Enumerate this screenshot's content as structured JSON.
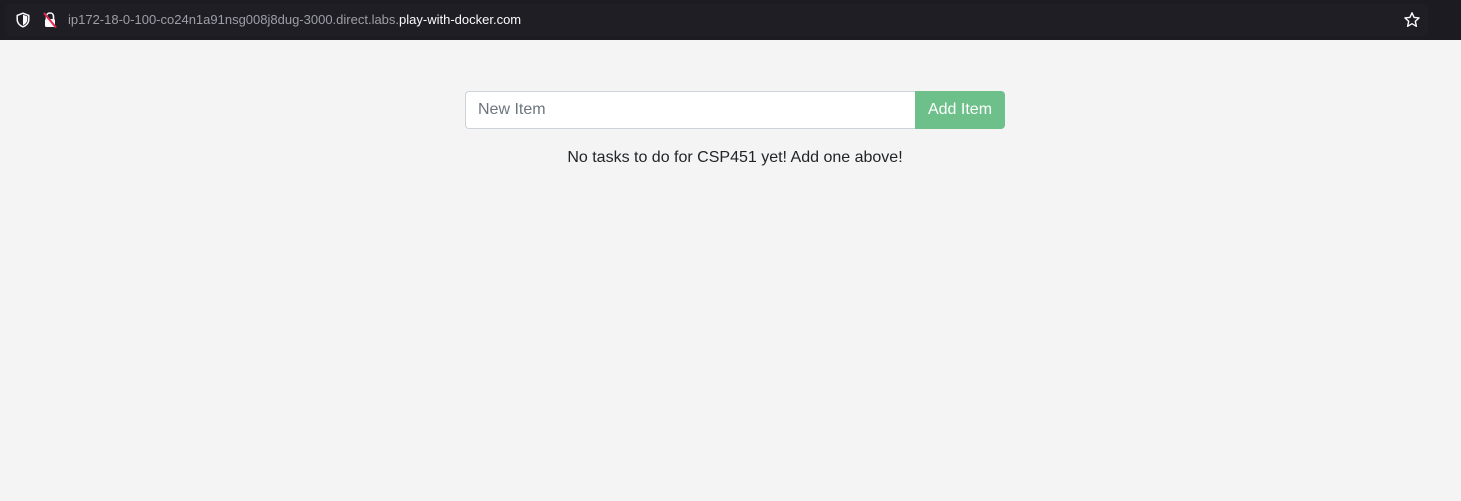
{
  "browser": {
    "url_subdomain": "ip172-18-0-100-co24n1a91nsg008j8dug-3000.direct.labs.",
    "url_domain": "play-with-docker.com",
    "icons": [
      "shield-icon",
      "insecure-lock-icon",
      "star-icon"
    ]
  },
  "form": {
    "input_placeholder": "New Item",
    "input_value": "",
    "add_button_label": "Add Item"
  },
  "list": {
    "empty_message": "No tasks to do for CSP451 yet! Add one above!"
  },
  "colors": {
    "chrome_bg": "#1c1b22",
    "page_bg": "#f4f4f4",
    "button_bg": "#6dc08a",
    "lock_accent": "#e22850"
  }
}
